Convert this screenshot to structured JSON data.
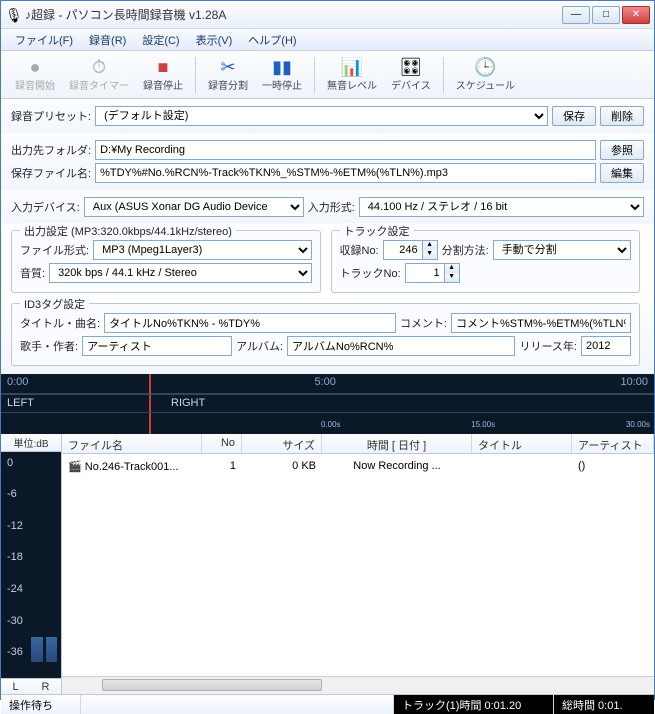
{
  "window": {
    "title": "♪超録 - パソコン長時間録音機 v1.28A"
  },
  "menu": {
    "file": "ファイル(F)",
    "rec": "録音(R)",
    "settings": "設定(C)",
    "view": "表示(V)",
    "help": "ヘルプ(H)"
  },
  "toolbar": {
    "recstart": "録音開始",
    "rectimer": "録音タイマー",
    "recstop": "録音停止",
    "split": "録音分割",
    "pause": "一時停止",
    "level": "無音レベル",
    "device": "デバイス",
    "schedule": "スケジュール"
  },
  "preset": {
    "label": "録音プリセット:",
    "value": "(デフォルト設定)",
    "save": "保存",
    "delete": "削除"
  },
  "output": {
    "folder_label": "出力先フォルダ:",
    "folder": "D:¥My Recording",
    "browse": "参照",
    "file_label": "保存ファイル名:",
    "file": "%TDY%#No.%RCN%-Track%TKN%_%STM%-%ETM%(%TLN%).mp3",
    "edit": "編集"
  },
  "input": {
    "device_label": "入力デバイス:",
    "device": "Aux (ASUS Xonar DG Audio Device",
    "format_label": "入力形式:",
    "format": "44.100 Hz / ステレオ / 16 bit"
  },
  "outset": {
    "legend": "出力設定 (MP3:320.0kbps/44.1kHz/stereo)",
    "filetype_label": "ファイル形式:",
    "filetype": "MP3 (Mpeg1Layer3)",
    "quality_label": "音質:",
    "quality": "320k bps / 44.1 kHz / Stereo"
  },
  "trackset": {
    "legend": "トラック設定",
    "recno_label": "収録No:",
    "recno": "246",
    "splitmethod_label": "分割方法:",
    "splitmethod": "手動で分割",
    "trackno_label": "トラックNo:",
    "trackno": "1"
  },
  "id3": {
    "legend": "ID3タグ設定",
    "title_label": "タイトル・曲名:",
    "title": "タイトルNo%TKN% - %TDY%",
    "comment_label": "コメント:",
    "comment": "コメント%STM%-%ETM%(%TLN%)",
    "artist_label": "歌手・作者:",
    "artist": "アーティスト",
    "album_label": "アルバム:",
    "album": "アルバムNo%RCN%",
    "year_label": "リリース年:",
    "year": "2012"
  },
  "timeline": {
    "t0": "0:00",
    "t5": "5:00",
    "t10": "10:00",
    "left": "LEFT",
    "right": "RIGHT",
    "s0": "0.00s",
    "s15": "15.00s",
    "s30": "30.00s"
  },
  "db": {
    "header": "単位:dB",
    "levels": [
      "0",
      "-6",
      "-12",
      "-18",
      "-24",
      "-30",
      "-36"
    ],
    "L": "L",
    "R": "R"
  },
  "filelist": {
    "h_fn": "ファイル名",
    "h_no": "No",
    "h_sz": "サイズ",
    "h_tm": "時間 [ 日付 ]",
    "h_ti": "タイトル",
    "h_ar": "アーティスト (?",
    "rows": [
      {
        "fn": "No.246-Track001...",
        "no": "1",
        "sz": "0 KB",
        "tm": "Now Recording ...",
        "ti": "",
        "ar": "()"
      }
    ]
  },
  "status": {
    "left": "操作待ち",
    "track": "トラック(1)時間 0:01.20",
    "total": "総時間 0:01."
  }
}
